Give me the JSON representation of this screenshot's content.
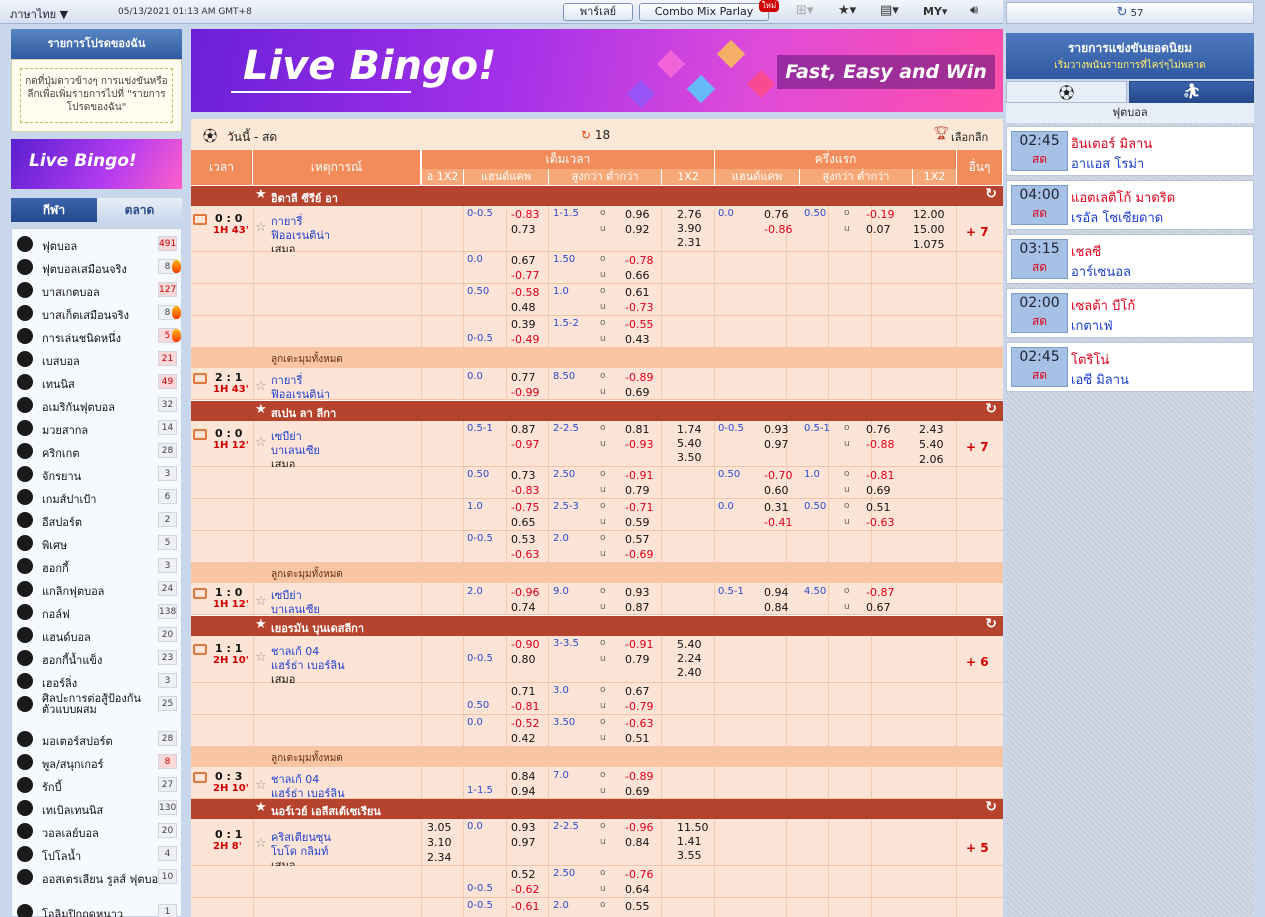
{
  "topbar": {
    "language": "ภาษาไทย",
    "datetime": "05/13/2021 01:13 AM GMT+8",
    "parlay_label": "พาร์เลย์",
    "combo_label": "Combo Mix Parlay",
    "new_badge": "ใหม่",
    "odds_type": "MY"
  },
  "favorites": {
    "title": "รายการโปรดของฉัน",
    "hint": "กดที่ปุ่มดาวข้างๆ การแข่งขันหรือลีกเพื่อเพิ่มรายการไปที่ \"รายการโปรดของฉัน\""
  },
  "banner": {
    "title": "Live Bingo!",
    "tagline": "Fast, Easy and Win",
    "small_title": "Live Bingo!"
  },
  "left_tabs": [
    "กีฬา",
    "ตลาด"
  ],
  "sports": [
    {
      "name": "ฟุตบอล",
      "count": "491",
      "hot": true,
      "flame": false,
      "icon": "soccer-icon"
    },
    {
      "name": "ฟุตบอลเสมือนจริง",
      "count": "8",
      "hot": false,
      "flame": true,
      "icon": "virtual-soccer-icon"
    },
    {
      "name": "บาสเกตบอล",
      "count": "127",
      "hot": true,
      "flame": false,
      "icon": "basketball-icon"
    },
    {
      "name": "บาสเก็ตเสมือนจริง",
      "count": "8",
      "hot": false,
      "flame": true,
      "icon": "virtual-basketball-icon"
    },
    {
      "name": "การเล่นชนิดหนึ่ง",
      "count": "5",
      "hot": true,
      "flame": true,
      "icon": "number-game-icon"
    },
    {
      "name": "เบสบอล",
      "count": "21",
      "hot": true,
      "flame": false,
      "icon": "baseball-icon"
    },
    {
      "name": "เทนนิส",
      "count": "49",
      "hot": true,
      "flame": false,
      "icon": "tennis-icon"
    },
    {
      "name": "อเมริกันฟุตบอล",
      "count": "32",
      "hot": false,
      "flame": false,
      "icon": "american-football-icon"
    },
    {
      "name": "มวยสากล",
      "count": "14",
      "hot": false,
      "flame": false,
      "icon": "boxing-icon"
    },
    {
      "name": "คริกเกต",
      "count": "28",
      "hot": false,
      "flame": false,
      "icon": "cricket-icon"
    },
    {
      "name": "จักรยาน",
      "count": "3",
      "hot": false,
      "flame": false,
      "icon": "cycling-icon"
    },
    {
      "name": "เกมส์ปาเป้า",
      "count": "6",
      "hot": false,
      "flame": false,
      "icon": "darts-icon"
    },
    {
      "name": "อีสปอร์ต",
      "count": "2",
      "hot": false,
      "flame": false,
      "icon": "esports-icon"
    },
    {
      "name": "พิเศษ",
      "count": "5",
      "hot": false,
      "flame": false,
      "icon": "special-icon"
    },
    {
      "name": "ฮอกกี้",
      "count": "3",
      "hot": false,
      "flame": false,
      "icon": "hockey-icon"
    },
    {
      "name": "แกลิกฟุตบอล",
      "count": "24",
      "hot": false,
      "flame": false,
      "icon": "gaelic-football-icon"
    },
    {
      "name": "กอล์ฟ",
      "count": "138",
      "hot": false,
      "flame": false,
      "icon": "golf-icon"
    },
    {
      "name": "แฮนด์บอล",
      "count": "20",
      "hot": false,
      "flame": false,
      "icon": "handball-icon"
    },
    {
      "name": "ฮอกกี้น้ำแข็ง",
      "count": "23",
      "hot": false,
      "flame": false,
      "icon": "ice-hockey-icon"
    },
    {
      "name": "เฮอร์ลิ่ง",
      "count": "3",
      "hot": false,
      "flame": false,
      "icon": "hurling-icon"
    },
    {
      "name": "ศิลปะการต่อสู้ป้องกันตัวแบบผสม",
      "count": "25",
      "hot": false,
      "flame": false,
      "icon": "mma-icon"
    },
    {
      "name": "มอเตอร์สปอร์ต",
      "count": "28",
      "hot": false,
      "flame": false,
      "icon": "motorsport-icon"
    },
    {
      "name": "พูล/สนุกเกอร์",
      "count": "8",
      "hot": true,
      "flame": false,
      "icon": "snooker-icon"
    },
    {
      "name": "รักบี้",
      "count": "27",
      "hot": false,
      "flame": false,
      "icon": "rugby-icon"
    },
    {
      "name": "เทเบิลเทนนิส",
      "count": "130",
      "hot": false,
      "flame": false,
      "icon": "table-tennis-icon"
    },
    {
      "name": "วอลเลย์บอล",
      "count": "20",
      "hot": false,
      "flame": false,
      "icon": "volleyball-icon"
    },
    {
      "name": "โปโลน้ำ",
      "count": "4",
      "hot": false,
      "flame": false,
      "icon": "water-polo-icon"
    },
    {
      "name": "ออสเตรเลียน รูลส์ ฟุตบอล",
      "count": "10",
      "hot": false,
      "flame": false,
      "icon": "aussie-rules-icon"
    },
    {
      "name": "โอลิมปิกฤดูหนาว",
      "count": "1",
      "hot": false,
      "flame": false,
      "icon": "winter-olympics-icon"
    }
  ],
  "main_header": {
    "title": "วันนี้ - สด",
    "refresh_count": "18",
    "pick_league": "เลือกลีก"
  },
  "columns": {
    "time": "เวลา",
    "event": "เหตุการณ์",
    "fulltime": "เต็มเวลา",
    "firsthalf": "ครึ่งแรก",
    "other": "อื่นๆ",
    "ft_1x2_partial": "อ 1X2",
    "handicap": "แฮนด์แคพ",
    "overunder": "สูงกว่า ต่ำกว่า",
    "x12": "1X2"
  },
  "corner_label": "ลูกเตะมุมทั้งหมด",
  "leagues": [
    {
      "name": "อิตาลี ซีรีย์ อา"
    },
    {
      "name": "สเปน ลา ลีกา"
    },
    {
      "name": "เยอรมัน บุนเดสลีกา"
    },
    {
      "name": "นอร์เวย์ เอลีสเต้เซเรียน"
    }
  ],
  "matches": [
    {
      "score": "0 : 0",
      "time": "1H 43'",
      "home": "กายารี่",
      "away": "ฟิออเรนติน่า",
      "draw": "เสมอ",
      "more": "+ 7"
    },
    {
      "score": "2 : 1",
      "time": "1H 43'",
      "home": "กายารี่",
      "away": "ฟิออเรนติน่า"
    },
    {
      "score": "0 : 0",
      "time": "1H 12'",
      "home": "เซบีย่า",
      "away": "บาเลนเซีย",
      "draw": "เสมอ",
      "more": "+ 7"
    },
    {
      "score": "1 : 0",
      "time": "1H 12'",
      "home": "เซบีย่า",
      "away": "บาเลนเซีย"
    },
    {
      "score": "1 : 1",
      "time": "2H 10'",
      "home": "ชาลเก้ 04",
      "away": "แฮร์ธ่า เบอร์ลิน",
      "draw": "เสมอ",
      "more": "+ 6"
    },
    {
      "score": "0 : 3",
      "time": "2H 10'",
      "home": "ชาลเก้ 04",
      "away": "แฮร์ธ่า เบอร์ลิน"
    },
    {
      "score": "0 : 1",
      "time": "2H 8'",
      "home": "คริสเตียนซุน",
      "away": "โบโด กลิมท์",
      "draw": "เสมอ",
      "more": "+ 5"
    }
  ],
  "odds_text": {
    "r1": [
      "0-0.5",
      "-0.83",
      "0.73",
      "1-1.5",
      "o",
      "u",
      "0.96",
      "0.92",
      "2.76",
      "3.90",
      "2.31",
      "0.0",
      "0.76",
      "-0.86",
      "0.50",
      "o",
      "u",
      "-0.19",
      "0.07",
      "12.00",
      "15.00",
      "1.075"
    ],
    "r2": [
      "0.0",
      "0.67",
      "-0.77",
      "1.50",
      "o",
      "u",
      "-0.78",
      "0.66"
    ],
    "r3": [
      "0.50",
      "-0.58",
      "0.48",
      "1.0",
      "o",
      "u",
      "0.61",
      "-0.73"
    ],
    "r4": [
      "0-0.5",
      "0.39",
      "-0.49",
      "1.5-2",
      "o",
      "u",
      "-0.55",
      "0.43"
    ],
    "r5": [
      "0.0",
      "0.77",
      "-0.99",
      "8.50",
      "o",
      "u",
      "-0.89",
      "0.69"
    ],
    "r6": [
      "0.5-1",
      "0.87",
      "-0.97",
      "2-2.5",
      "o",
      "u",
      "0.81",
      "-0.93",
      "1.74",
      "5.40",
      "3.50",
      "0-0.5",
      "0.93",
      "0.97",
      "0.5-1",
      "o",
      "u",
      "0.76",
      "-0.88",
      "2.43",
      "5.40",
      "2.06"
    ],
    "r7": [
      "0.50",
      "0.73",
      "-0.83",
      "2.50",
      "o",
      "u",
      "-0.91",
      "0.79",
      "0.50",
      "-0.70",
      "0.60",
      "1.0",
      "o",
      "u",
      "-0.81",
      "0.69"
    ],
    "r8": [
      "1.0",
      "-0.75",
      "0.65",
      "2.5-3",
      "o",
      "u",
      "-0.71",
      "0.59",
      "0.0",
      "0.31",
      "-0.41",
      "0.50",
      "o",
      "u",
      "0.51",
      "-0.63"
    ],
    "r9": [
      "0-0.5",
      "0.53",
      "-0.63",
      "2.0",
      "o",
      "u",
      "0.57",
      "-0.69"
    ],
    "r10": [
      "2.0",
      "-0.96",
      "0.74",
      "9.0",
      "o",
      "u",
      "0.93",
      "0.87",
      "0.5-1",
      "0.94",
      "0.84",
      "4.50",
      "o",
      "u",
      "-0.87",
      "0.67"
    ],
    "r11": [
      "0-0.5",
      "-0.90",
      "0.80",
      "3-3.5",
      "o",
      "u",
      "-0.91",
      "0.79",
      "5.40",
      "2.24",
      "2.40"
    ],
    "r12": [
      "0.50",
      "0.71",
      "-0.81",
      "3.0",
      "o",
      "u",
      "0.67",
      "-0.79"
    ],
    "r13": [
      "0.0",
      "-0.52",
      "0.42",
      "3.50",
      "o",
      "u",
      "-0.63",
      "0.51"
    ],
    "r14": [
      "1-1.5",
      "0.84",
      "0.94",
      "7.0",
      "o",
      "u",
      "-0.89",
      "0.69"
    ],
    "r15": [
      "3.05",
      "3.10",
      "2.34",
      "0.0",
      "0.93",
      "0.97",
      "2-2.5",
      "o",
      "u",
      "-0.96",
      "0.84",
      "11.50",
      "1.41",
      "3.55"
    ],
    "r16": [
      "0-0.5",
      "0.52",
      "-0.62",
      "2.50",
      "o",
      "u",
      "-0.76",
      "0.64"
    ],
    "r17": [
      "0-0.5",
      "-0.61",
      "2.0",
      "o",
      "0.55"
    ]
  },
  "right": {
    "refresh_count": "57",
    "title": "รายการแข่งขันยอดนิยม",
    "subtitle": "เริ่มวางพนันรายการที่ไคร่ๆไม่พลาด",
    "sub_tab": "ฟุตบอล",
    "status": "สด",
    "popular": [
      {
        "time": "02:45",
        "home": "อินเตอร์ มิลาน",
        "away": "อาแอส โรม่า"
      },
      {
        "time": "04:00",
        "home": "แอตเลติโก้ มาดริด",
        "away": "เรอัล โซเซียดาด"
      },
      {
        "time": "03:15",
        "home": "เชลซี",
        "away": "อาร์เซนอล"
      },
      {
        "time": "02:00",
        "home": "เซลต้า บีโก้",
        "away": "เกตาเฟ่"
      },
      {
        "time": "02:45",
        "home": "โตริโน่",
        "away": "เอซี มิลาน"
      }
    ]
  },
  "colors": {
    "header_orange": "#f28c5a",
    "league_red": "#b5432d",
    "row_bg": "#fde4d6",
    "blue_text": "#1c3fd0",
    "red_text": "#e0001a"
  }
}
